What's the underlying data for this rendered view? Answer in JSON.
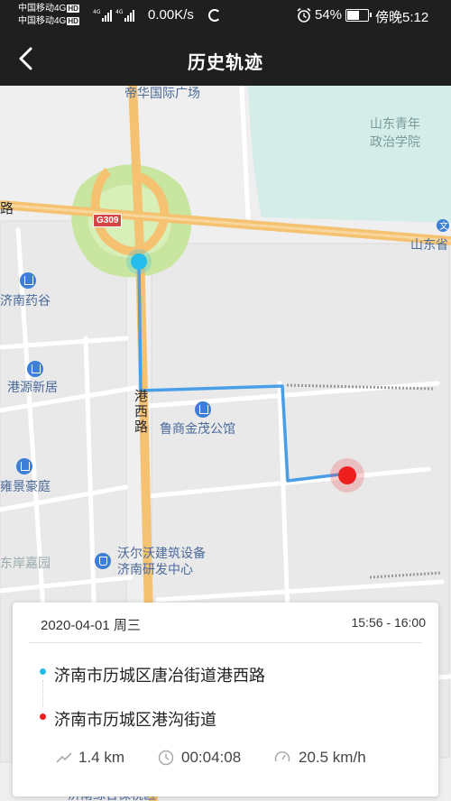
{
  "status_bar": {
    "carrier_1": "中国移动4G",
    "carrier_2": "中国移动4G",
    "hd_badge": "HD",
    "net_speed": "0.00K/s",
    "battery_percent": "54%",
    "time": "傍晚5:12",
    "battery_level": 0.54
  },
  "nav": {
    "title": "历史轨迹",
    "back_icon": "chevron-left-icon"
  },
  "map": {
    "labels": {
      "dihua_plaza": "帝华国际广场",
      "shandong_college_1": "山东青年",
      "shandong_college_2": "政治学院",
      "road_edge": "路",
      "highway_shield": "G309",
      "shandong_right": "山东省",
      "jinan_yaogu": "济南药谷",
      "gangyuan": "港源新居",
      "gangxi_road_1": "港",
      "gangxi_road_2": "西",
      "gangxi_road_3": "路",
      "lushang": "鲁商金茂公馆",
      "yajing": "雍景豪庭",
      "volvo_1": "沃尔沃建筑设备",
      "volvo_2": "济南研发中心",
      "donganjia": "东岸嘉园",
      "bonded_zone": "济南综合保税区"
    },
    "colors": {
      "track": "#4a9ee8",
      "main_road": "#f5c271",
      "start": "#24bceb",
      "end": "#ee1f1f",
      "water": "#d4ede9",
      "park": "#c8e6a0"
    }
  },
  "trip": {
    "date": "2020-04-01 周三",
    "time_range": "15:56 - 16:00",
    "start_address": "济南市历城区唐冶街道港西路",
    "end_address": "济南市历城区港沟街道",
    "distance": "1.4 km",
    "duration": "00:04:08",
    "avg_speed": "20.5 km/h",
    "distance_icon": "trend-icon",
    "duration_icon": "clock-icon",
    "speed_icon": "speedometer-icon"
  }
}
